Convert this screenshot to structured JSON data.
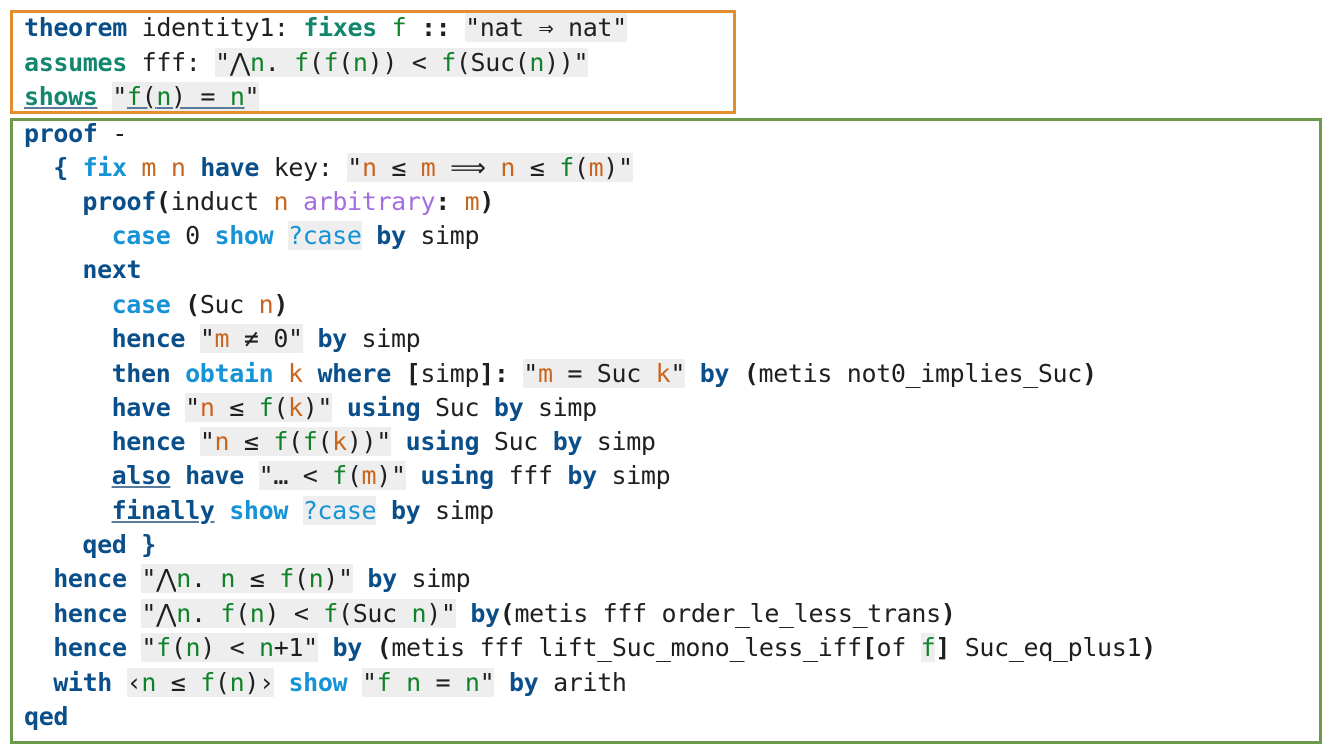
{
  "colors": {
    "theorem_box_border": "#e38d2f",
    "proof_box_border": "#6a9a4a",
    "keyword": "#0b4f8a",
    "fixes_keyword": "#12876e",
    "case_keyword": "#1593d6",
    "free_var": "#10832a",
    "bound_var": "#c8651f",
    "attribute": "#a56ee0",
    "string_bg": "#eeeeee"
  },
  "lines": [
    {
      "indent": 0,
      "segments": [
        {
          "t": "theorem",
          "s": "kw"
        },
        {
          "t": " identity1: ",
          "s": "plain"
        },
        {
          "t": "fixes",
          "s": "fixkw"
        },
        {
          "t": " ",
          "s": "plain"
        },
        {
          "t": "f",
          "s": "free"
        },
        {
          "t": " :: ",
          "s": "bold"
        },
        {
          "t": "\"nat ⇒ nat\"",
          "s": "str"
        }
      ]
    },
    {
      "indent": 0,
      "segments": [
        {
          "t": "assumes",
          "s": "fixkw"
        },
        {
          "t": " fff: ",
          "s": "plain"
        },
        {
          "t": "\"⋀",
          "s": "str"
        },
        {
          "t": "n",
          "s": "str-free"
        },
        {
          "t": ". ",
          "s": "str"
        },
        {
          "t": "f",
          "s": "str-free"
        },
        {
          "t": "(",
          "s": "str"
        },
        {
          "t": "f",
          "s": "str-free"
        },
        {
          "t": "(",
          "s": "str"
        },
        {
          "t": "n",
          "s": "str-free"
        },
        {
          "t": ")) < ",
          "s": "str"
        },
        {
          "t": "f",
          "s": "str-free"
        },
        {
          "t": "(Suc(",
          "s": "str"
        },
        {
          "t": "n",
          "s": "str-free"
        },
        {
          "t": "))\"",
          "s": "str"
        }
      ]
    },
    {
      "indent": 0,
      "segments": [
        {
          "t": "shows",
          "s": "fixkw-u"
        },
        {
          "t": " ",
          "s": "plain"
        },
        {
          "t": "\"",
          "s": "str"
        },
        {
          "t": "f",
          "s": "str-free-u"
        },
        {
          "t": "(",
          "s": "str-u"
        },
        {
          "t": "n",
          "s": "str-free-u"
        },
        {
          "t": ") = ",
          "s": "str-u"
        },
        {
          "t": "n",
          "s": "str-free-u"
        },
        {
          "t": "\"",
          "s": "str"
        }
      ]
    },
    {
      "indent": 0,
      "segments": [
        {
          "t": "proof",
          "s": "kw"
        },
        {
          "t": " -",
          "s": "plain"
        }
      ]
    },
    {
      "indent": 2,
      "segments": [
        {
          "t": "{ ",
          "s": "kw"
        },
        {
          "t": "fix",
          "s": "cs"
        },
        {
          "t": " ",
          "s": "plain"
        },
        {
          "t": "m",
          "s": "bound"
        },
        {
          "t": " ",
          "s": "plain"
        },
        {
          "t": "n",
          "s": "bound"
        },
        {
          "t": " ",
          "s": "plain"
        },
        {
          "t": "have",
          "s": "kw"
        },
        {
          "t": " key: ",
          "s": "plain"
        },
        {
          "t": "\"",
          "s": "str"
        },
        {
          "t": "n",
          "s": "str-bound"
        },
        {
          "t": " ≤ ",
          "s": "str"
        },
        {
          "t": "m",
          "s": "str-bound"
        },
        {
          "t": " ⟹ ",
          "s": "str"
        },
        {
          "t": "n",
          "s": "str-bound"
        },
        {
          "t": " ≤ ",
          "s": "str"
        },
        {
          "t": "f",
          "s": "str-free"
        },
        {
          "t": "(",
          "s": "str"
        },
        {
          "t": "m",
          "s": "str-bound"
        },
        {
          "t": ")\"",
          "s": "str"
        }
      ]
    },
    {
      "indent": 4,
      "segments": [
        {
          "t": "proof",
          "s": "kw"
        },
        {
          "t": "(",
          "s": "bold"
        },
        {
          "t": "induct ",
          "s": "plain"
        },
        {
          "t": "n",
          "s": "bound"
        },
        {
          "t": " ",
          "s": "plain"
        },
        {
          "t": "arbitrary",
          "s": "attr"
        },
        {
          "t": ": ",
          "s": "bold"
        },
        {
          "t": "m",
          "s": "bound"
        },
        {
          "t": ")",
          "s": "bold"
        }
      ]
    },
    {
      "indent": 6,
      "segments": [
        {
          "t": "case",
          "s": "cs"
        },
        {
          "t": " 0 ",
          "s": "plain"
        },
        {
          "t": "show",
          "s": "cs"
        },
        {
          "t": " ",
          "s": "plain"
        },
        {
          "t": "?case",
          "s": "str-blue"
        },
        {
          "t": " ",
          "s": "plain"
        },
        {
          "t": "by",
          "s": "kw"
        },
        {
          "t": " simp",
          "s": "plain"
        }
      ]
    },
    {
      "indent": 4,
      "segments": [
        {
          "t": "next",
          "s": "kw"
        }
      ]
    },
    {
      "indent": 6,
      "segments": [
        {
          "t": "case",
          "s": "cs"
        },
        {
          "t": " ",
          "s": "plain"
        },
        {
          "t": "(",
          "s": "bold"
        },
        {
          "t": "Suc ",
          "s": "plain"
        },
        {
          "t": "n",
          "s": "bound"
        },
        {
          "t": ")",
          "s": "bold"
        }
      ]
    },
    {
      "indent": 6,
      "segments": [
        {
          "t": "hence",
          "s": "kw"
        },
        {
          "t": " ",
          "s": "plain"
        },
        {
          "t": "\"",
          "s": "str"
        },
        {
          "t": "m",
          "s": "str-bound"
        },
        {
          "t": " ≠ 0\"",
          "s": "str"
        },
        {
          "t": " ",
          "s": "plain"
        },
        {
          "t": "by",
          "s": "kw"
        },
        {
          "t": " simp",
          "s": "plain"
        }
      ]
    },
    {
      "indent": 6,
      "segments": [
        {
          "t": "then",
          "s": "kw"
        },
        {
          "t": " ",
          "s": "plain"
        },
        {
          "t": "obtain",
          "s": "cs"
        },
        {
          "t": " ",
          "s": "plain"
        },
        {
          "t": "k",
          "s": "bound"
        },
        {
          "t": " ",
          "s": "plain"
        },
        {
          "t": "where",
          "s": "kw"
        },
        {
          "t": " ",
          "s": "plain"
        },
        {
          "t": "[",
          "s": "bold"
        },
        {
          "t": "simp",
          "s": "plain"
        },
        {
          "t": "]: ",
          "s": "bold"
        },
        {
          "t": "\"",
          "s": "str"
        },
        {
          "t": "m",
          "s": "str-bound"
        },
        {
          "t": " = Suc ",
          "s": "str"
        },
        {
          "t": "k",
          "s": "str-bound"
        },
        {
          "t": "\"",
          "s": "str"
        },
        {
          "t": " ",
          "s": "plain"
        },
        {
          "t": "by",
          "s": "kw"
        },
        {
          "t": " ",
          "s": "plain"
        },
        {
          "t": "(",
          "s": "bold"
        },
        {
          "t": "metis not0_implies_Suc",
          "s": "plain"
        },
        {
          "t": ")",
          "s": "bold"
        }
      ]
    },
    {
      "indent": 6,
      "segments": [
        {
          "t": "have",
          "s": "kw"
        },
        {
          "t": " ",
          "s": "plain"
        },
        {
          "t": "\"",
          "s": "str"
        },
        {
          "t": "n",
          "s": "str-bound"
        },
        {
          "t": " ≤ ",
          "s": "str"
        },
        {
          "t": "f",
          "s": "str-free"
        },
        {
          "t": "(",
          "s": "str"
        },
        {
          "t": "k",
          "s": "str-bound"
        },
        {
          "t": ")\"",
          "s": "str"
        },
        {
          "t": " ",
          "s": "plain"
        },
        {
          "t": "using",
          "s": "kw"
        },
        {
          "t": " Suc ",
          "s": "plain"
        },
        {
          "t": "by",
          "s": "kw"
        },
        {
          "t": " simp",
          "s": "plain"
        }
      ]
    },
    {
      "indent": 6,
      "segments": [
        {
          "t": "hence",
          "s": "kw"
        },
        {
          "t": " ",
          "s": "plain"
        },
        {
          "t": "\"",
          "s": "str"
        },
        {
          "t": "n",
          "s": "str-bound"
        },
        {
          "t": " ≤ ",
          "s": "str"
        },
        {
          "t": "f",
          "s": "str-free"
        },
        {
          "t": "(",
          "s": "str"
        },
        {
          "t": "f",
          "s": "str-free"
        },
        {
          "t": "(",
          "s": "str"
        },
        {
          "t": "k",
          "s": "str-bound"
        },
        {
          "t": "))\"",
          "s": "str"
        },
        {
          "t": " ",
          "s": "plain"
        },
        {
          "t": "using",
          "s": "kw"
        },
        {
          "t": " Suc ",
          "s": "plain"
        },
        {
          "t": "by",
          "s": "kw"
        },
        {
          "t": " simp",
          "s": "plain"
        }
      ]
    },
    {
      "indent": 6,
      "segments": [
        {
          "t": "also",
          "s": "kw-u"
        },
        {
          "t": " ",
          "s": "plain"
        },
        {
          "t": "have",
          "s": "kw"
        },
        {
          "t": " ",
          "s": "plain"
        },
        {
          "t": "\"… < ",
          "s": "str"
        },
        {
          "t": "f",
          "s": "str-free"
        },
        {
          "t": "(",
          "s": "str"
        },
        {
          "t": "m",
          "s": "str-bound"
        },
        {
          "t": ")\"",
          "s": "str"
        },
        {
          "t": " ",
          "s": "plain"
        },
        {
          "t": "using",
          "s": "kw"
        },
        {
          "t": " fff ",
          "s": "plain"
        },
        {
          "t": "by",
          "s": "kw"
        },
        {
          "t": " simp",
          "s": "plain"
        }
      ]
    },
    {
      "indent": 6,
      "segments": [
        {
          "t": "finally",
          "s": "kw-u"
        },
        {
          "t": " ",
          "s": "plain"
        },
        {
          "t": "show",
          "s": "cs"
        },
        {
          "t": " ",
          "s": "plain"
        },
        {
          "t": "?case",
          "s": "str-blue"
        },
        {
          "t": " ",
          "s": "plain"
        },
        {
          "t": "by",
          "s": "kw"
        },
        {
          "t": " simp",
          "s": "plain"
        }
      ]
    },
    {
      "indent": 4,
      "segments": [
        {
          "t": "qed",
          "s": "kw"
        },
        {
          "t": " ",
          "s": "plain"
        },
        {
          "t": "}",
          "s": "kw"
        }
      ]
    },
    {
      "indent": 2,
      "segments": [
        {
          "t": "hence",
          "s": "kw"
        },
        {
          "t": " ",
          "s": "plain"
        },
        {
          "t": "\"⋀",
          "s": "str"
        },
        {
          "t": "n",
          "s": "str-free"
        },
        {
          "t": ". ",
          "s": "str"
        },
        {
          "t": "n",
          "s": "str-free"
        },
        {
          "t": " ≤ ",
          "s": "str"
        },
        {
          "t": "f",
          "s": "str-free"
        },
        {
          "t": "(",
          "s": "str"
        },
        {
          "t": "n",
          "s": "str-free"
        },
        {
          "t": ")\"",
          "s": "str"
        },
        {
          "t": " ",
          "s": "plain"
        },
        {
          "t": "by",
          "s": "kw"
        },
        {
          "t": " simp",
          "s": "plain"
        }
      ]
    },
    {
      "indent": 2,
      "segments": [
        {
          "t": "hence",
          "s": "kw"
        },
        {
          "t": " ",
          "s": "plain"
        },
        {
          "t": "\"⋀",
          "s": "str"
        },
        {
          "t": "n",
          "s": "str-free"
        },
        {
          "t": ". ",
          "s": "str"
        },
        {
          "t": "f",
          "s": "str-free"
        },
        {
          "t": "(",
          "s": "str"
        },
        {
          "t": "n",
          "s": "str-free"
        },
        {
          "t": ") < ",
          "s": "str"
        },
        {
          "t": "f",
          "s": "str-free"
        },
        {
          "t": "(Suc ",
          "s": "str"
        },
        {
          "t": "n",
          "s": "str-free"
        },
        {
          "t": ")\"",
          "s": "str"
        },
        {
          "t": " ",
          "s": "plain"
        },
        {
          "t": "by",
          "s": "kw"
        },
        {
          "t": "(",
          "s": "bold"
        },
        {
          "t": "metis fff order_le_less_trans",
          "s": "plain"
        },
        {
          "t": ")",
          "s": "bold"
        }
      ]
    },
    {
      "indent": 2,
      "segments": [
        {
          "t": "hence",
          "s": "kw"
        },
        {
          "t": " ",
          "s": "plain"
        },
        {
          "t": "\"",
          "s": "str"
        },
        {
          "t": "f",
          "s": "str-free"
        },
        {
          "t": "(",
          "s": "str"
        },
        {
          "t": "n",
          "s": "str-free"
        },
        {
          "t": ") < ",
          "s": "str"
        },
        {
          "t": "n",
          "s": "str-free"
        },
        {
          "t": "+1\"",
          "s": "str"
        },
        {
          "t": " ",
          "s": "plain"
        },
        {
          "t": "by",
          "s": "kw"
        },
        {
          "t": " ",
          "s": "plain"
        },
        {
          "t": "(",
          "s": "bold"
        },
        {
          "t": "metis fff lift_Suc_mono_less_iff",
          "s": "plain"
        },
        {
          "t": "[",
          "s": "bold"
        },
        {
          "t": "of ",
          "s": "plain"
        },
        {
          "t": "f",
          "s": "str-free"
        },
        {
          "t": "]",
          "s": "bold"
        },
        {
          "t": " Suc_eq_plus1",
          "s": "plain"
        },
        {
          "t": ")",
          "s": "bold"
        }
      ]
    },
    {
      "indent": 2,
      "segments": [
        {
          "t": "with",
          "s": "kw"
        },
        {
          "t": " ",
          "s": "plain"
        },
        {
          "t": "‹",
          "s": "str"
        },
        {
          "t": "n",
          "s": "str-free"
        },
        {
          "t": " ≤ ",
          "s": "str"
        },
        {
          "t": "f",
          "s": "str-free"
        },
        {
          "t": "(",
          "s": "str"
        },
        {
          "t": "n",
          "s": "str-free"
        },
        {
          "t": ")›",
          "s": "str"
        },
        {
          "t": " ",
          "s": "plain"
        },
        {
          "t": "show",
          "s": "cs"
        },
        {
          "t": " ",
          "s": "plain"
        },
        {
          "t": "\"",
          "s": "str"
        },
        {
          "t": "f",
          "s": "str-free"
        },
        {
          "t": " ",
          "s": "str"
        },
        {
          "t": "n",
          "s": "str-free"
        },
        {
          "t": " = ",
          "s": "str"
        },
        {
          "t": "n",
          "s": "str-free"
        },
        {
          "t": "\"",
          "s": "str"
        },
        {
          "t": " ",
          "s": "plain"
        },
        {
          "t": "by",
          "s": "kw"
        },
        {
          "t": " arith",
          "s": "plain"
        }
      ]
    },
    {
      "indent": 0,
      "segments": [
        {
          "t": "qed",
          "s": "kw"
        }
      ]
    }
  ]
}
